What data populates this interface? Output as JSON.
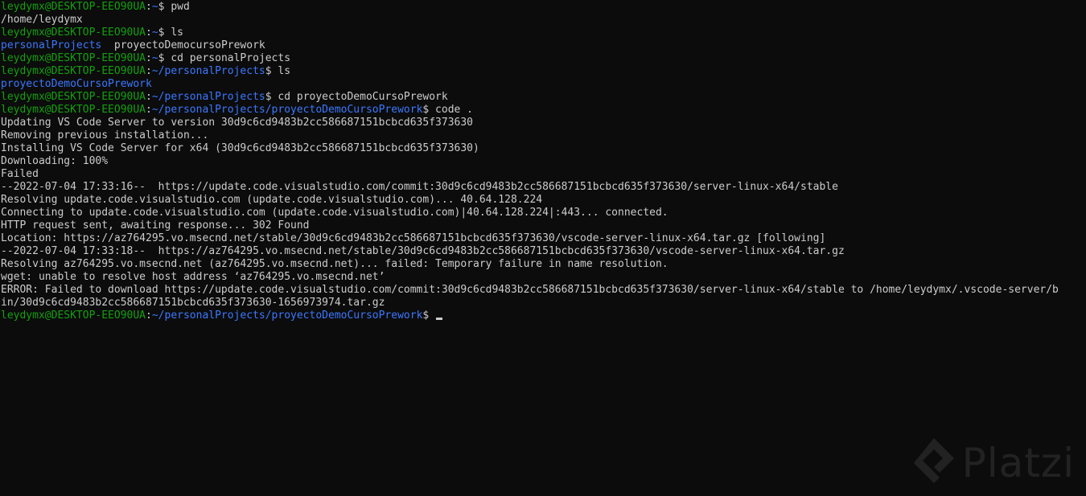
{
  "terminal": {
    "user_host": "leydymx@DESKTOP-EEO90UA",
    "lines": [
      {
        "type": "prompt",
        "path": "~",
        "command": "pwd"
      },
      {
        "type": "out",
        "text": "/home/leydymx"
      },
      {
        "type": "prompt",
        "path": "~",
        "command": "ls"
      },
      {
        "type": "ls",
        "items": [
          {
            "text": "personalProjects",
            "kind": "dir"
          },
          {
            "text": "  proyectoDemocursoPrework",
            "kind": "plain"
          }
        ]
      },
      {
        "type": "prompt",
        "path": "~",
        "command": "cd personalProjects"
      },
      {
        "type": "prompt",
        "path": "~/personalProjects",
        "command": "ls"
      },
      {
        "type": "ls",
        "items": [
          {
            "text": "proyectoDemoCursoPrework",
            "kind": "dir"
          }
        ]
      },
      {
        "type": "prompt",
        "path": "~/personalProjects",
        "command": "cd proyectoDemoCursoPrework"
      },
      {
        "type": "prompt",
        "path": "~/personalProjects/proyectoDemoCursoPrework",
        "command": "code ."
      },
      {
        "type": "out",
        "text": "Updating VS Code Server to version 30d9c6cd9483b2cc586687151bcbcd635f373630"
      },
      {
        "type": "out",
        "text": "Removing previous installation..."
      },
      {
        "type": "out",
        "text": "Installing VS Code Server for x64 (30d9c6cd9483b2cc586687151bcbcd635f373630)"
      },
      {
        "type": "out",
        "text": "Downloading: 100%"
      },
      {
        "type": "out",
        "text": "Failed"
      },
      {
        "type": "out",
        "text": "--2022-07-04 17:33:16--  https://update.code.visualstudio.com/commit:30d9c6cd9483b2cc586687151bcbcd635f373630/server-linux-x64/stable"
      },
      {
        "type": "out",
        "text": "Resolving update.code.visualstudio.com (update.code.visualstudio.com)... 40.64.128.224"
      },
      {
        "type": "out",
        "text": "Connecting to update.code.visualstudio.com (update.code.visualstudio.com)|40.64.128.224|:443... connected."
      },
      {
        "type": "out",
        "text": "HTTP request sent, awaiting response... 302 Found"
      },
      {
        "type": "out",
        "text": "Location: https://az764295.vo.msecnd.net/stable/30d9c6cd9483b2cc586687151bcbcd635f373630/vscode-server-linux-x64.tar.gz [following]"
      },
      {
        "type": "out",
        "text": "--2022-07-04 17:33:18--  https://az764295.vo.msecnd.net/stable/30d9c6cd9483b2cc586687151bcbcd635f373630/vscode-server-linux-x64.tar.gz"
      },
      {
        "type": "out",
        "text": "Resolving az764295.vo.msecnd.net (az764295.vo.msecnd.net)... failed: Temporary failure in name resolution."
      },
      {
        "type": "out",
        "text": "wget: unable to resolve host address ‘az764295.vo.msecnd.net’"
      },
      {
        "type": "out",
        "text": "ERROR: Failed to download https://update.code.visualstudio.com/commit:30d9c6cd9483b2cc586687151bcbcd635f373630/server-linux-x64/stable to /home/leydymx/.vscode-server/b"
      },
      {
        "type": "out",
        "text": "in/30d9c6cd9483b2cc586687151bcbcd635f373630-1656973974.tar.gz"
      },
      {
        "type": "prompt",
        "path": "~/personalProjects/proyectoDemoCursoPrework",
        "command": "",
        "cursor": true
      }
    ]
  },
  "watermark": {
    "text": "Platzi",
    "icon": "platzi-logo-icon"
  },
  "colors": {
    "background": "#0c0c0c",
    "text": "#cccccc",
    "user": "#13a10e",
    "path": "#3b78ff"
  }
}
